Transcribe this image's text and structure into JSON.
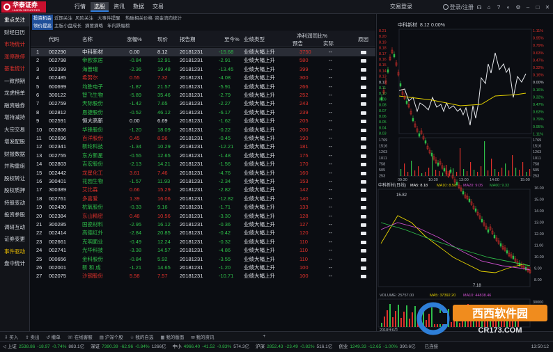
{
  "app": {
    "logo": "华泰证券",
    "logo_sub": "HUATAI SECURITIES",
    "top_tabs": [
      "行情",
      "选股",
      "资讯",
      "数据",
      "交易"
    ],
    "active_top_tab": "选股",
    "login": "交易登录",
    "user": "登录/注册",
    "tool_icons": [
      "headset-icon",
      "home-icon",
      "help-icon",
      "skin-icon",
      "settings-icon",
      "minimize-icon",
      "maximize-icon",
      "close-icon"
    ]
  },
  "left_nav": [
    {
      "label": "重点关注",
      "style": "act"
    },
    {
      "label": "财经日历",
      "style": "normal"
    },
    {
      "label": "市场统计",
      "style": "red"
    },
    {
      "label": "涨停跌停",
      "style": "red"
    },
    {
      "label": "基准统计",
      "style": "red"
    },
    {
      "label": "一致预期",
      "style": "normal"
    },
    {
      "label": "龙虎榜单",
      "style": "normal"
    },
    {
      "label": "融资融券",
      "style": "normal"
    },
    {
      "label": "增持减持",
      "style": "normal"
    },
    {
      "label": "大宗交易",
      "style": "normal"
    },
    {
      "label": "增发配股",
      "style": "normal"
    },
    {
      "label": "财报数据",
      "style": "normal"
    },
    {
      "label": "并购重组",
      "style": "normal"
    },
    {
      "label": "股权转让",
      "style": "normal"
    },
    {
      "label": "股权质押",
      "style": "normal"
    },
    {
      "label": "持股变动",
      "style": "normal"
    },
    {
      "label": "投资参股",
      "style": "normal"
    },
    {
      "label": "调研互动",
      "style": "normal"
    },
    {
      "label": "证券变更",
      "style": "normal"
    },
    {
      "label": "事件驱动",
      "style": "yel"
    },
    {
      "label": "盘中统计",
      "style": "normal"
    }
  ],
  "sub_tabs_row1": [
    "投资机会",
    "近期关注",
    "风险关注",
    "大事件提醒",
    "热破相关价格",
    "资金流向统计"
  ],
  "sub_tabs_row2": [
    "领价提高",
    "主板小盘成长",
    "摘要摘略",
    "年内跌幅榜"
  ],
  "table": {
    "headers": {
      "idx": "",
      "code": "代码",
      "name": "名称",
      "chg": "涨幅%",
      "price": "现价",
      "report": "报告期",
      "ytd": "至今%",
      "type": "业绩类型",
      "profit": "净利润同比%",
      "forecast": "预告",
      "actual": "实际",
      "reason": "原因"
    },
    "rows": [
      {
        "idx": "1",
        "code": "002290",
        "name": "中科新材",
        "chg": "0.00",
        "price": "8.12",
        "report": "20181231",
        "ytd": "-15.68",
        "type": "业绩大幅上升",
        "forecast": "3750",
        "actual": "--",
        "dir": "flat"
      },
      {
        "idx": "2",
        "code": "002798",
        "name": "帝欧家居",
        "chg": "-0.84",
        "price": "12.91",
        "report": "20181231",
        "ytd": "-2.91",
        "type": "业绩大幅上升",
        "forecast": "580",
        "actual": "--",
        "dir": "dn"
      },
      {
        "idx": "3",
        "code": "002399",
        "name": "海普瑞",
        "chg": "-2.36",
        "price": "19.48",
        "report": "20181231",
        "ytd": "-13.45",
        "type": "业绩大幅上升",
        "forecast": "399",
        "actual": "--",
        "dir": "dn"
      },
      {
        "idx": "4",
        "code": "002485",
        "name": "希努尔",
        "chg": "0.55",
        "price": "7.32",
        "report": "20181231",
        "ytd": "-4.08",
        "type": "业绩大幅上升",
        "forecast": "300",
        "actual": "--",
        "dir": "up"
      },
      {
        "idx": "5",
        "code": "600699",
        "name": "均胜电子",
        "chg": "-1.87",
        "price": "21.57",
        "report": "20181231",
        "ytd": "-5.91",
        "type": "业绩大幅上升",
        "forecast": "266",
        "actual": "--",
        "dir": "dn"
      },
      {
        "idx": "6",
        "code": "300122",
        "name": "智飞生物",
        "chg": "-5.89",
        "price": "35.46",
        "report": "20181231",
        "ytd": "-2.79",
        "type": "业绩大幅上升",
        "forecast": "252",
        "actual": "--",
        "dir": "dn"
      },
      {
        "idx": "7",
        "code": "002759",
        "name": "天际股份",
        "chg": "-1.42",
        "price": "7.65",
        "report": "20181231",
        "ytd": "-2.27",
        "type": "业绩大幅上升",
        "forecast": "243",
        "actual": "--",
        "dir": "dn"
      },
      {
        "idx": "8",
        "code": "002812",
        "name": "恩捷股份",
        "chg": "-0.52",
        "price": "46.12",
        "report": "20181231",
        "ytd": "-6.17",
        "type": "业绩大幅上升",
        "forecast": "239",
        "actual": "--",
        "dir": "dn"
      },
      {
        "idx": "9",
        "code": "002591",
        "name": "恒大高新",
        "chg": "0.00",
        "price": "6.69",
        "report": "20181231",
        "ytd": "-1.62",
        "type": "业绩大幅上升",
        "forecast": "205",
        "actual": "--",
        "dir": "flat"
      },
      {
        "idx": "10",
        "code": "002806",
        "name": "华锋股份",
        "chg": "-1.20",
        "price": "18.09",
        "report": "20181231",
        "ytd": "-0.22",
        "type": "业绩大幅上升",
        "forecast": "200",
        "actual": "--",
        "dir": "dn"
      },
      {
        "idx": "11",
        "code": "002696",
        "name": "百洋股份",
        "chg": "0.45",
        "price": "8.96",
        "report": "20181231",
        "ytd": "-0.45",
        "type": "业绩大幅上升",
        "forecast": "190",
        "actual": "--",
        "dir": "up"
      },
      {
        "idx": "12",
        "code": "002341",
        "name": "新纶科技",
        "chg": "-1.34",
        "price": "10.29",
        "report": "20181231",
        "ytd": "-12.21",
        "type": "业绩大幅上升",
        "forecast": "181",
        "actual": "--",
        "dir": "dn"
      },
      {
        "idx": "13",
        "code": "002755",
        "name": "东方新星",
        "chg": "-0.55",
        "price": "12.65",
        "report": "20181231",
        "ytd": "-1.48",
        "type": "业绩大幅上升",
        "forecast": "175",
        "actual": "--",
        "dir": "dn"
      },
      {
        "idx": "14",
        "code": "002803",
        "name": "吉宏股份",
        "chg": "-2.13",
        "price": "14.21",
        "report": "20181231",
        "ytd": "-1.56",
        "type": "业绩大幅上升",
        "forecast": "170",
        "actual": "--",
        "dir": "dn"
      },
      {
        "idx": "15",
        "code": "002442",
        "name": "龙星化工",
        "chg": "3.61",
        "price": "7.46",
        "report": "20181231",
        "ytd": "-4.76",
        "type": "业绩大幅上升",
        "forecast": "160",
        "actual": "--",
        "dir": "up"
      },
      {
        "idx": "16",
        "code": "300401",
        "name": "花园生物",
        "chg": "-1.57",
        "price": "11.93",
        "report": "20181231",
        "ytd": "-2.34",
        "type": "业绩大幅上升",
        "forecast": "153",
        "actual": "--",
        "dir": "dn"
      },
      {
        "idx": "17",
        "code": "300389",
        "name": "艾比森",
        "chg": "0.66",
        "price": "15.29",
        "report": "20181231",
        "ytd": "-2.82",
        "type": "业绩大幅上升",
        "forecast": "142",
        "actual": "--",
        "dir": "up"
      },
      {
        "idx": "18",
        "code": "002761",
        "name": "多喜爱",
        "chg": "1.39",
        "price": "16.06",
        "report": "20181231",
        "ytd": "-12.82",
        "type": "业绩大幅上升",
        "forecast": "140",
        "actual": "--",
        "dir": "up"
      },
      {
        "idx": "19",
        "code": "002430",
        "name": "杭氧股份",
        "chg": "-0.33",
        "price": "9.16",
        "report": "20181231",
        "ytd": "-1.71",
        "type": "业绩大幅上升",
        "forecast": "133",
        "actual": "--",
        "dir": "dn"
      },
      {
        "idx": "20",
        "code": "002384",
        "name": "东山精密",
        "chg": "0.48",
        "price": "10.56",
        "report": "20181231",
        "ytd": "-3.30",
        "type": "业绩大幅上升",
        "forecast": "128",
        "actual": "--",
        "dir": "up"
      },
      {
        "idx": "21",
        "code": "300285",
        "name": "国瓷材料",
        "chg": "-2.95",
        "price": "16.12",
        "report": "20181231",
        "ytd": "-0.36",
        "type": "业绩大幅上升",
        "forecast": "127",
        "actual": "--",
        "dir": "dn"
      },
      {
        "idx": "22",
        "code": "002414",
        "name": "高德红外",
        "chg": "-2.84",
        "price": "20.85",
        "report": "20181231",
        "ytd": "-0.42",
        "type": "业绩大幅上升",
        "forecast": "120",
        "actual": "--",
        "dir": "dn"
      },
      {
        "idx": "23",
        "code": "002661",
        "name": "克明面业",
        "chg": "-0.49",
        "price": "12.24",
        "report": "20181231",
        "ytd": "-0.32",
        "type": "业绩大幅上升",
        "forecast": "110",
        "actual": "--",
        "dir": "dn"
      },
      {
        "idx": "24",
        "code": "002741",
        "name": "光华科技",
        "chg": "-3.38",
        "price": "14.57",
        "report": "20181231",
        "ytd": "-4.86",
        "type": "业绩大幅上升",
        "forecast": "110",
        "actual": "--",
        "dir": "dn"
      },
      {
        "idx": "25",
        "code": "000656",
        "name": "金科股份",
        "chg": "-0.84",
        "price": "5.92",
        "report": "20181231",
        "ytd": "-3.55",
        "type": "业绩大幅上升",
        "forecast": "110",
        "actual": "--",
        "dir": "dn"
      },
      {
        "idx": "26",
        "code": "002001",
        "name": "新 和 成",
        "chg": "-1.21",
        "price": "14.65",
        "report": "20181231",
        "ytd": "-1.20",
        "type": "业绩大幅上升",
        "forecast": "100",
        "actual": "--",
        "dir": "dn"
      },
      {
        "idx": "27",
        "code": "002075",
        "name": "沙钢股份",
        "chg": "5.58",
        "price": "7.57",
        "report": "20181231",
        "ytd": "-10.71",
        "type": "业绩大幅上升",
        "forecast": "100",
        "actual": "--",
        "dir": "up"
      }
    ]
  },
  "intraday": {
    "title": "中科新材",
    "price": "8.12",
    "pct": "0.00%",
    "left_axis": [
      "8.21",
      "8.20",
      "8.19",
      "8.18",
      "8.17",
      "8.16",
      "8.15",
      "8.14",
      "8.13",
      "8.12",
      "8.11",
      "8.10",
      "8.09",
      "8.08",
      "8.07",
      "8.06",
      "8.05",
      "8.04",
      "8.03"
    ],
    "right_axis": [
      "1.11%",
      "0.95%",
      "0.79%",
      "0.63%",
      "0.47%",
      "0.32%",
      "0.16%",
      "0.00%",
      "0.16%",
      "0.32%",
      "0.47%",
      "0.63%",
      "0.79%",
      "0.95%",
      "1.11%"
    ],
    "vol_axis_left": [
      "1769",
      "1516",
      "1263",
      "1011",
      "758",
      "505",
      "253"
    ],
    "vol_axis_right": [
      "1769",
      "1516",
      "1263",
      "1011",
      "758",
      "505",
      "253"
    ],
    "times": [
      "09:30",
      "10:30",
      "13:00",
      "14:00",
      "15:00"
    ]
  },
  "kline": {
    "header": "中科新材(日线)",
    "ma": [
      {
        "label": "MA5: 8.18",
        "color": "#ffffff"
      },
      {
        "label": "MA10: 8.58",
        "color": "#e6d200"
      },
      {
        "label": "MA20: 9.05",
        "color": "#d050d0"
      },
      {
        "label": "MA60: 9.32",
        "color": "#2fbf4a"
      }
    ],
    "high_label": "15.82",
    "low_label": "7.18",
    "axis": [
      "16.00",
      "15.00",
      "14.00",
      "13.00",
      "12.00",
      "11.00",
      "10.00",
      "9.00",
      "8.00"
    ]
  },
  "volume": {
    "label": "VOLUME: 25757.00",
    "ma5": "MA5: 37392.20",
    "ma10": "MA10: 44838.46",
    "axis": [
      "30000",
      "20000",
      "10000"
    ],
    "date_label": "2018年6月"
  },
  "bottom_toolbar": [
    "买入",
    "卖出",
    "撤单",
    "在线客服",
    "沪深个股",
    "我的自选",
    "我的版面",
    "我的资讯"
  ],
  "status": {
    "items": [
      {
        "label": "上证",
        "value": "2538.86",
        "chg": "-18.97",
        "pct": "-0.74%",
        "vol": "883.1亿"
      },
      {
        "label": "深证",
        "value": "7390.39",
        "chg": "-62.96",
        "pct": "-0.84%",
        "vol": "1266亿"
      },
      {
        "label": "中小",
        "value": "4966.40",
        "chg": "-41.52",
        "pct": "-0.83%",
        "vol": "574.3亿"
      },
      {
        "label": "沪深",
        "value": "2852.43",
        "chg": "-23.49",
        "pct": "-0.82%",
        "vol": "516.1亿"
      },
      {
        "label": "创业",
        "value": "1249.33",
        "chg": "-12.65",
        "pct": "-1.00%",
        "vol": "390.6亿"
      }
    ],
    "connected": "已连接",
    "clock": "13:50:12"
  },
  "watermark": {
    "text": "西西软件园",
    "url": "CR173.COM"
  }
}
